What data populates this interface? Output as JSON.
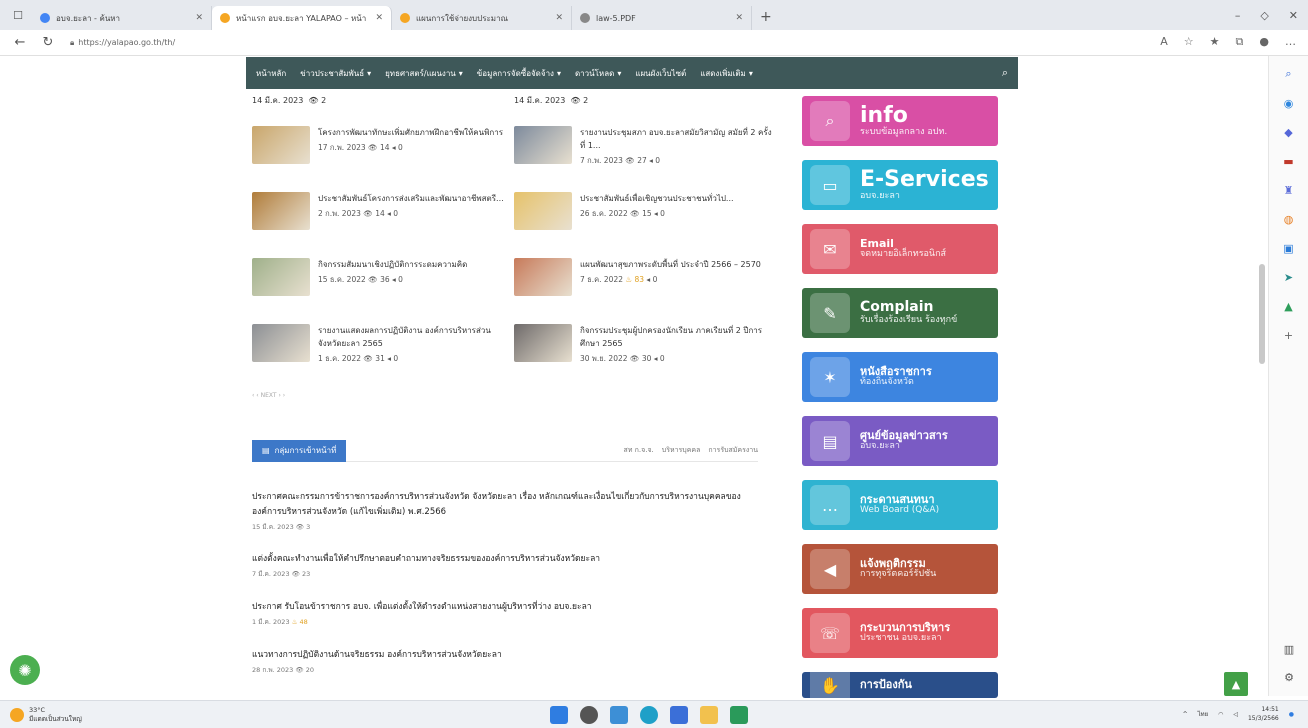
{
  "browser": {
    "tabs": [
      {
        "title": "อบจ.ยะลา - ค้นหา",
        "active": false,
        "color": "#4285f4"
      },
      {
        "title": "หน้าแรก อบจ.ยะลา YALAPAO – หน้า",
        "active": true,
        "color": "#f5a623"
      },
      {
        "title": "แผนการใช้จ่ายงบประมาณ",
        "active": false,
        "color": "#f5a623"
      },
      {
        "title": "law-5.PDF",
        "active": false,
        "color": "#888888"
      }
    ],
    "url": "https://yalapao.go.th/th/"
  },
  "site_nav": {
    "items": [
      "หน้าหลัก",
      "ข่าวประชาสัมพันธ์",
      "ยุทธศาสตร์/แผนงาน",
      "ข้อมูลการจัดซื้อจัดจ้าง",
      "ดาวน์โหลด",
      "แผนผังเว็บไซต์",
      "แสดงเพิ่มเติม"
    ]
  },
  "news": {
    "date_left": "14 มี.ค. 2023",
    "date_left_views": "2",
    "date_right": "14 มี.ค. 2023",
    "date_right_views": "2",
    "left": [
      {
        "title": "โครงการพัฒนาทักษะเพิ่มศักยภาพฝึกอาชีพให้คนพิการ",
        "date": "17 ก.พ. 2023",
        "views": "14",
        "shares": "0",
        "hot": false
      },
      {
        "title": "ประชาสัมพันธ์โครงการส่งเสริมและพัฒนาอาชีพสตรี...",
        "date": "2 ก.พ. 2023",
        "views": "14",
        "shares": "0",
        "hot": false
      },
      {
        "title": "กิจกรรมสัมมนาเชิงปฏิบัติการระดมความคิด",
        "date": "15 ธ.ค. 2022",
        "views": "36",
        "shares": "0",
        "hot": false
      },
      {
        "title": "รายงานแสดงผลการปฏิบัติงาน องค์การบริหารส่วนจังหวัดยะลา 2565",
        "date": "1 ธ.ค. 2022",
        "views": "31",
        "shares": "0",
        "hot": false
      }
    ],
    "right": [
      {
        "title": "รายงานประชุมสภา อบจ.ยะลาสมัยวิสามัญ สมัยที่ 2 ครั้งที่ 1...",
        "date": "7 ก.พ. 2023",
        "views": "27",
        "shares": "0",
        "hot": false
      },
      {
        "title": "ประชาสัมพันธ์เพื่อเชิญชวนประชาชนทั่วไป...",
        "date": "26 ธ.ค. 2022",
        "views": "15",
        "shares": "0",
        "hot": false
      },
      {
        "title": "แผนพัฒนาสุขภาพระดับพื้นที่ ประจำปี 2566 – 2570",
        "date": "7 ธ.ค. 2022",
        "views": "83",
        "shares": "0",
        "hot": true
      },
      {
        "title": "กิจกรรมประชุมผู้ปกครองนักเรียน ภาคเรียนที่ 2 ปีการศึกษา 2565",
        "date": "30 พ.ย. 2022",
        "views": "30",
        "shares": "0",
        "hot": false
      }
    ],
    "pager": "‹  ‹ NEXT ›  ›"
  },
  "duty": {
    "tab": "กลุ่มการเข้าหน้าที่",
    "links": [
      "สท ก.จ.จ.",
      "บริหารบุคคล",
      "การรับสมัครงาน"
    ],
    "items": [
      {
        "title": "ประกาศคณะกรรมการข้าราชการองค์การบริหารส่วนจังหวัด จังหวัดยะลา เรื่อง หลักเกณฑ์และเงื่อนไขเกี่ยวกับการบริหารงานบุคคลขององค์การบริหารส่วนจังหวัด (แก้ไขเพิ่มเติม) พ.ศ.2566",
        "date": "15 มี.ค. 2023",
        "views": "3",
        "hot": false
      },
      {
        "title": "แต่งตั้งคณะทำงานเพื่อให้คำปรึกษาตอบคำถามทางจริยธรรมขององค์การบริหารส่วนจังหวัดยะลา",
        "date": "7 มี.ค. 2023",
        "views": "23",
        "hot": false
      },
      {
        "title": "ประกาศ รับโอนข้าราชการ อบจ. เพื่อแต่งตั้งให้ดำรงตำแหน่งสายงานผู้บริหารที่ว่าง อบจ.ยะลา",
        "date": "1 มี.ค. 2023",
        "views": "48",
        "hot": true
      },
      {
        "title": "แนวทางการปฏิบัติงานด้านจริยธรรม องค์การบริหารส่วนจังหวัดยะลา",
        "date": "28 ก.พ. 2023",
        "views": "20",
        "hot": false
      }
    ]
  },
  "banners": [
    {
      "title": "info",
      "sub": "ระบบข้อมูลกลาง อปท.",
      "color": "#d94fa5",
      "icon": "magnifier-icon",
      "glyph": "⌕",
      "size": "big"
    },
    {
      "title": "E-Services",
      "sub": "อบจ.ยะลา",
      "color": "#2bb3d4",
      "icon": "laptop-icon",
      "glyph": "▭",
      "size": "big"
    },
    {
      "title": "Email",
      "sub": "จดหมายอิเล็กทรอนิกส์",
      "color": "#e05a6a",
      "icon": "envelope-icon",
      "glyph": "✉",
      "size": "thai"
    },
    {
      "title": "Complain",
      "sub": "รับเรื่องร้องเรียน ร้องทุกข์",
      "color": "#3b6f43",
      "icon": "ballot-icon",
      "glyph": "✎",
      "size": "mid"
    },
    {
      "title": "หนังสือราชการ",
      "sub": "ท้องถิ่นจังหวัด",
      "color": "#3d85e0",
      "icon": "garuda-icon",
      "glyph": "✶",
      "size": "thai"
    },
    {
      "title": "ศูนย์ข้อมูลข่าวสาร",
      "sub": "อบจ.ยะลา",
      "color": "#7a5bc4",
      "icon": "folder-icon",
      "glyph": "▤",
      "size": "thai"
    },
    {
      "title": "กระดานสนทนา",
      "sub": "Web Board (Q&A)",
      "color": "#2fb3d1",
      "icon": "chat-bubble-icon",
      "glyph": "…",
      "size": "thai"
    },
    {
      "title": "แจ้งพฤติกรรม",
      "sub": "การทุจริตคอร์รัปชัน",
      "color": "#b5543a",
      "icon": "megaphone-icon",
      "glyph": "◀",
      "size": "thai"
    },
    {
      "title": "กระบวนการบริหาร",
      "sub": "ประชาชน อบจ.ยะลา",
      "color": "#e2575f",
      "icon": "support-icon",
      "glyph": "☏",
      "size": "thai"
    },
    {
      "title": "การป้องกัน",
      "sub": "",
      "color": "#2a4f8a",
      "icon": "hand-icon",
      "glyph": "✋",
      "size": "thai"
    }
  ],
  "taskbar": {
    "weather_temp": "33°C",
    "weather_desc": "มีแดดเป็นส่วนใหญ่",
    "lang": "ไทย",
    "time": "14:51",
    "date": "15/3/2566"
  }
}
